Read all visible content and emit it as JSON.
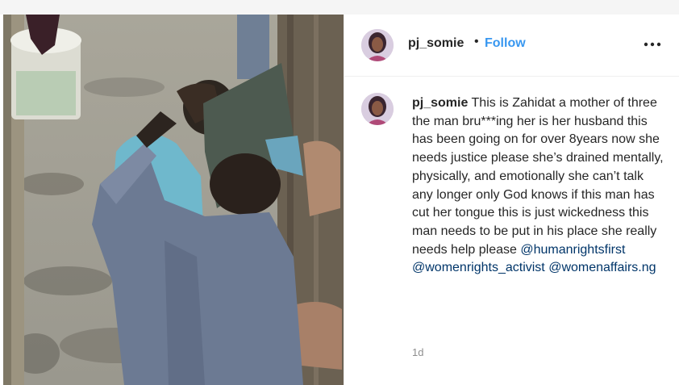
{
  "header": {
    "username": "pj_somie",
    "separator": "•",
    "follow_label": "Follow",
    "more_icon": "more-horizontal-icon"
  },
  "caption": {
    "username": "pj_somie",
    "text": "This is Zahidat a mother of three the man bru***ing her is her husband this has been going on for over 8years now she needs justice please she’s drained mentally, physically, and emotionally she can’t talk any longer only God knows if this man has cut her tongue this is just wickedness this man needs to be put in his place she really needs help please",
    "mentions": [
      "@humanrightsfirst",
      "@womenrights_activist",
      "@womenaffairs.ng"
    ]
  },
  "timestamp": "1d",
  "colors": {
    "link_blue": "#3897f0",
    "mention_blue": "#003569",
    "text": "#262626",
    "muted": "#8e8e8e"
  }
}
